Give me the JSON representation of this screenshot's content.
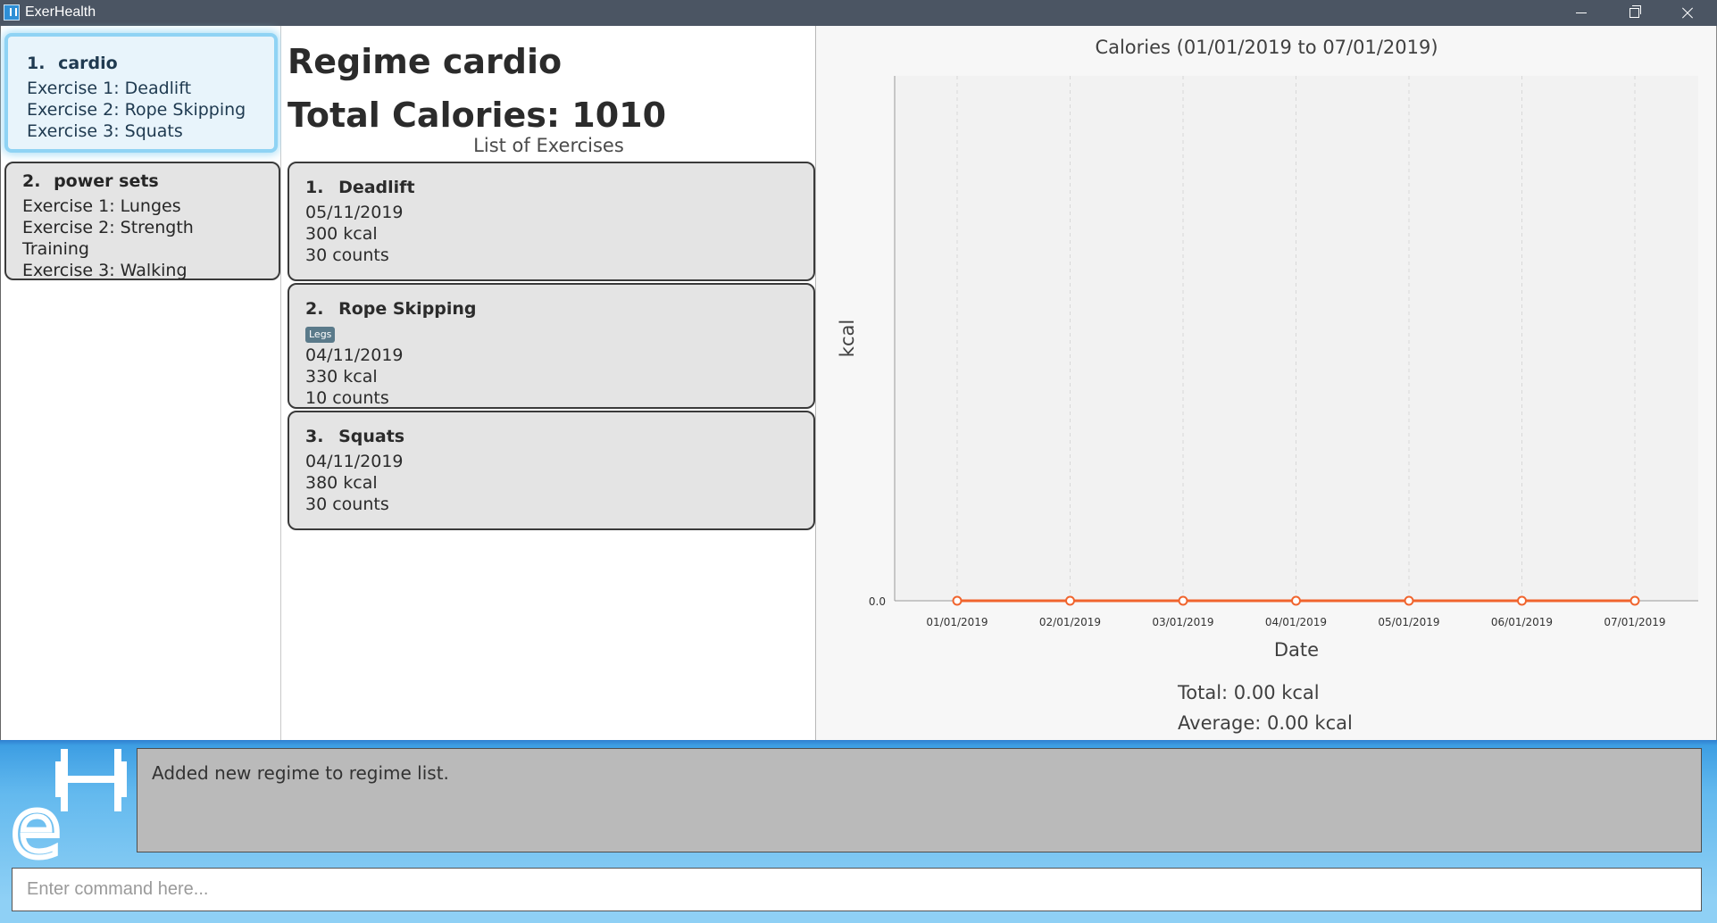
{
  "window": {
    "title": "ExerHealth"
  },
  "regimes": [
    {
      "index": "1.",
      "name": "cardio",
      "exercises": [
        "Exercise 1: Deadlift",
        "Exercise 2: Rope Skipping",
        "Exercise 3: Squats"
      ]
    },
    {
      "index": "2.",
      "name": "power sets",
      "exercises": [
        "Exercise 1: Lunges",
        "Exercise 2: Strength Training",
        "Exercise 3: Walking"
      ]
    }
  ],
  "middle": {
    "regime_title": "Regime cardio",
    "total_calories": "Total Calories: 1010",
    "list_title": "List of Exercises",
    "exercises": [
      {
        "index": "1.",
        "name": "Deadlift",
        "tag": "",
        "date": "05/11/2019",
        "calories": "300 kcal",
        "quantity": "30 counts"
      },
      {
        "index": "2.",
        "name": "Rope Skipping",
        "tag": "Legs",
        "date": "04/11/2019",
        "calories": "330 kcal",
        "quantity": "10 counts"
      },
      {
        "index": "3.",
        "name": "Squats",
        "tag": "",
        "date": "04/11/2019",
        "calories": "380 kcal",
        "quantity": "30 counts"
      }
    ]
  },
  "chart": {
    "total": "Total: 0.00 kcal",
    "average": "Average: 0.00 kcal"
  },
  "chart_data": {
    "type": "line",
    "title": "Calories (01/01/2019 to 07/01/2019)",
    "xlabel": "Date",
    "ylabel": "kcal",
    "categories": [
      "01/01/2019",
      "02/01/2019",
      "03/01/2019",
      "04/01/2019",
      "05/01/2019",
      "06/01/2019",
      "07/01/2019"
    ],
    "series": [
      {
        "values": [
          0,
          0,
          0,
          0,
          0,
          0,
          0
        ],
        "color": "#f0642d"
      }
    ],
    "yticks": [
      "0.0"
    ],
    "grid": true
  },
  "result": {
    "text": "Added new regime to regime list."
  },
  "command": {
    "placeholder": "Enter command here..."
  },
  "colors": {
    "accent": "#3d9ee3",
    "series": "#f0642d",
    "selected_glow": "#8fd3f4"
  }
}
